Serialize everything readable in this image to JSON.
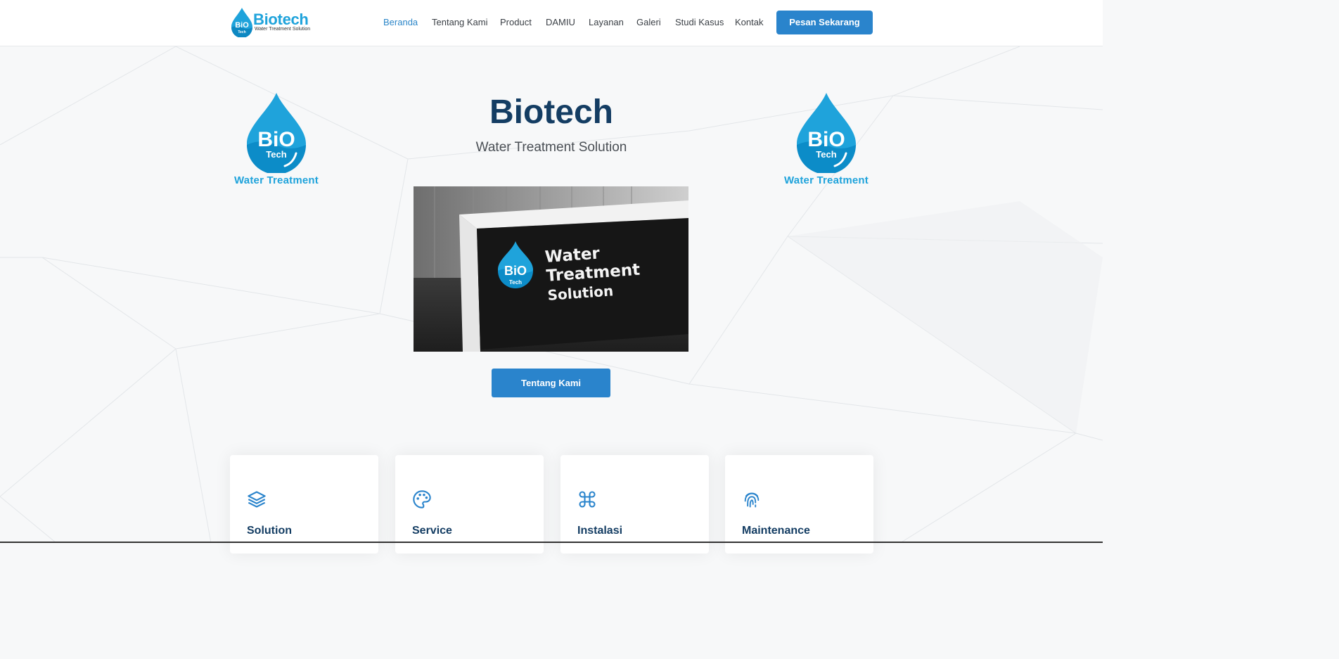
{
  "header": {
    "brand_name": "Biotech",
    "brand_tagline": "Water Treatment Solution",
    "brand_logo_text": "BiO",
    "brand_logo_sub": "Tech",
    "nav": [
      {
        "label": "Beranda",
        "active": true
      },
      {
        "label": "Tentang Kami",
        "active": false
      },
      {
        "label": "Product",
        "active": false
      },
      {
        "label": "DAMIU",
        "active": false
      },
      {
        "label": "Layanan",
        "active": false
      },
      {
        "label": "Galeri",
        "active": false
      },
      {
        "label": "Studi Kasus",
        "active": false
      },
      {
        "label": "Kontak",
        "active": false
      }
    ],
    "cta_label": "Pesan Sekarang"
  },
  "hero": {
    "title": "Biotech",
    "subtitle": "Water Treatment Solution",
    "logo_text": "BiO",
    "logo_sub": "Tech",
    "logo_caption": "Water Treatment",
    "photo_lines": [
      "Water",
      "Treatment",
      "Solution"
    ],
    "button_label": "Tentang Kami"
  },
  "cards": [
    {
      "title": "Solution",
      "icon": "layers-icon"
    },
    {
      "title": "Service",
      "icon": "palette-icon"
    },
    {
      "title": "Instalasi",
      "icon": "command-icon"
    },
    {
      "title": "Maintenance",
      "icon": "fingerprint-icon"
    }
  ],
  "colors": {
    "primary": "#2a84cc",
    "brand": "#1fa3db",
    "heading": "#143d63"
  }
}
